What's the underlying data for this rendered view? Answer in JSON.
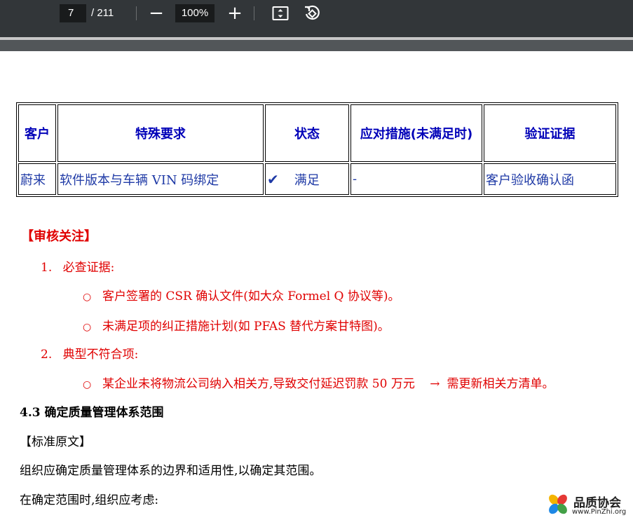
{
  "toolbar": {
    "page_current": "7",
    "page_total": "/ 211",
    "zoom_out": "−",
    "zoom_level": "100%",
    "zoom_in": "+"
  },
  "table": {
    "headers": [
      "客户",
      "特殊要求",
      "状态",
      "应对措施(未满足时)",
      "验证证据"
    ],
    "row": {
      "customer": "蔚来",
      "requirement": "软件版本与车辆 VIN 码绑定",
      "status_icon": "✔",
      "status": "满足",
      "measure": "-",
      "evidence": "客户验收确认函"
    }
  },
  "audit": {
    "title": "【审核关注】",
    "item1_num": "1.",
    "item1": "必查证据:",
    "item1_sub1": "客户签署的 CSR 确认文件(如大众 Formel Q 协议等)。",
    "item1_sub2": "未满足项的纠正措施计划(如 PFAS 替代方案甘特图)。",
    "item2_num": "2.",
    "item2": "典型不符合项:",
    "item2_sub1": "某企业未将物流公司纳入相关方,导致交付延迟罚款 50 万元",
    "item2_arrow": "→",
    "item2_sub1_tail": "需更新相关方清单。"
  },
  "section": {
    "heading": "4.3 确定质量管理体系范围",
    "std_label": "【标准原文】",
    "para1": "组织应确定质量管理体系的边界和适用性,以确定其范围。",
    "para2": "在确定范围时,组织应考虑:"
  },
  "watermark": {
    "name": "品质协会",
    "url": "www.PinZhi.org"
  }
}
